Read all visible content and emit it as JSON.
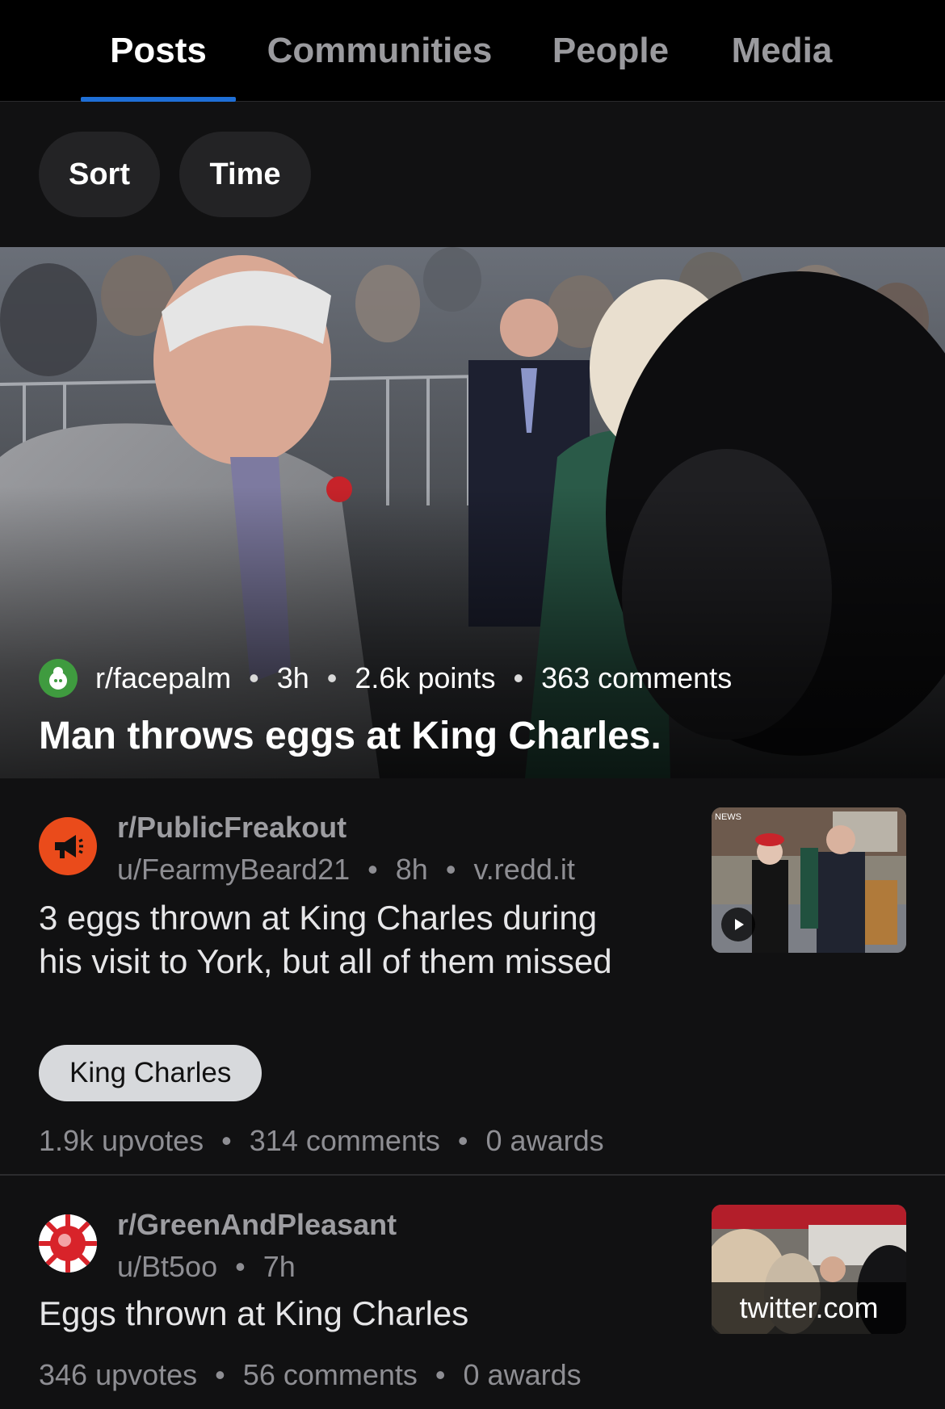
{
  "tabs": [
    {
      "label": "Posts",
      "active": true
    },
    {
      "label": "Communities",
      "active": false
    },
    {
      "label": "People",
      "active": false
    },
    {
      "label": "Media",
      "active": false
    }
  ],
  "filters": {
    "sort_label": "Sort",
    "time_label": "Time"
  },
  "hero_post": {
    "subreddit": "r/facepalm",
    "age": "3h",
    "points": "2.6k points",
    "comments": "363 comments",
    "title": "Man throws eggs at King Charles.",
    "subreddit_icon": "snoo-avatar-icon"
  },
  "posts": [
    {
      "subreddit": "r/PublicFreakout",
      "author": "u/FearmyBeard21",
      "age": "8h",
      "domain": "v.redd.it",
      "title": "3 eggs thrown at King Charles during his visit to York, but all of them missed",
      "flair": "King Charles",
      "upvotes": "1.9k upvotes",
      "comments": "314 comments",
      "awards": "0 awards",
      "thumb_badge": "NEWS",
      "subreddit_icon": "megaphone-icon"
    },
    {
      "subreddit": "r/GreenAndPleasant",
      "author": "u/Bt5oo",
      "age": "7h",
      "title": "Eggs thrown at King Charles",
      "upvotes": "346 upvotes",
      "comments": "56 comments",
      "awards": "0 awards",
      "link_label": "twitter.com",
      "subreddit_icon": "rose-icon"
    }
  ],
  "separator": "•",
  "colors": {
    "accent": "#1f6fd6",
    "background": "#111112",
    "tabbar": "#000000",
    "flair": "#d7d9dc",
    "megaphone_orange": "#ea4b1b"
  }
}
